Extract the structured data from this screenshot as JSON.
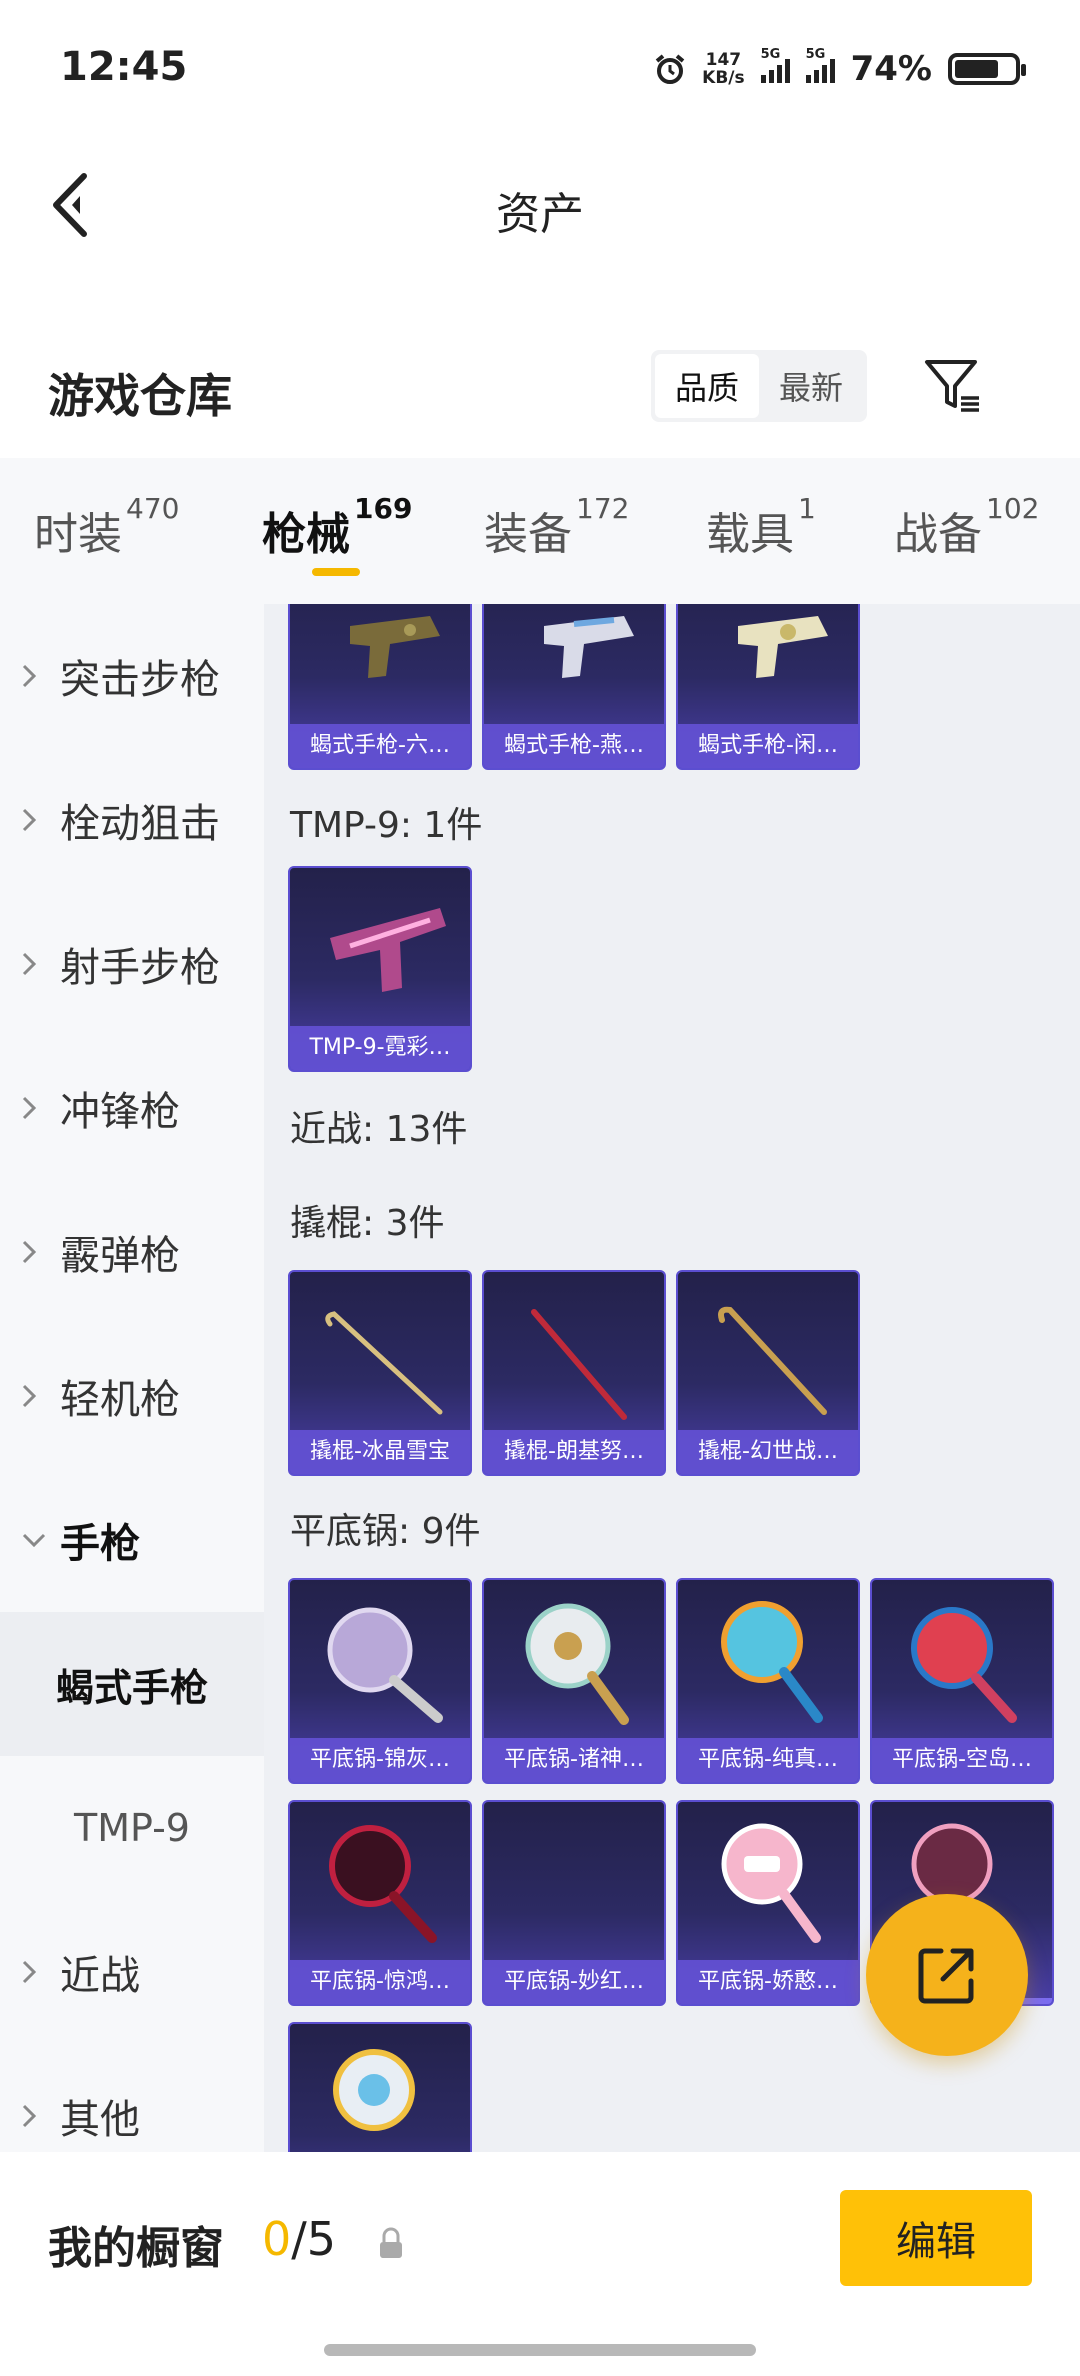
{
  "status_bar": {
    "time": "12:45",
    "net_speed_value": "147",
    "net_speed_unit": "KB/s",
    "signal_1_label": "5G",
    "signal_2_label": "5G",
    "battery_percent": "74%",
    "battery_level": 0.74,
    "icons": [
      "alarm-icon",
      "signal-icon",
      "battery-icon"
    ]
  },
  "header": {
    "title": "资产"
  },
  "warehouse": {
    "title": "游戏仓库",
    "sort_options": [
      "品质",
      "最新"
    ],
    "sort_selected": "品质"
  },
  "tabs": [
    {
      "label": "时装",
      "count": "470"
    },
    {
      "label": "枪械",
      "count": "169",
      "active": true
    },
    {
      "label": "装备",
      "count": "172"
    },
    {
      "label": "载具",
      "count": "1"
    },
    {
      "label": "战备",
      "count": "102"
    }
  ],
  "left_nav": {
    "items": [
      "突击步枪",
      "栓动狙击",
      "射手步枪",
      "冲锋枪",
      "霰弹枪",
      "轻机枪",
      "手枪",
      "近战",
      "其他"
    ],
    "expanded": "手枪",
    "sub_items": [
      "蝎式手枪",
      "TMP-9"
    ],
    "selected_sub": "蝎式手枪"
  },
  "content": {
    "top_cards": [
      "蝎式手枪-六…",
      "蝎式手枪-燕…",
      "蝎式手枪-闲…"
    ],
    "sections": [
      {
        "label": "TMP-9: 1件",
        "cards": [
          "TMP-9-霓彩…"
        ]
      },
      {
        "label": "近战: 13件",
        "cards": []
      },
      {
        "label": "撬棍: 3件",
        "cards": [
          "撬棍-冰晶雪宝",
          "撬棍-朗基努…",
          "撬棍-幻世战…"
        ]
      },
      {
        "label": "平底锅: 9件",
        "cards": [
          "平底锅-锦灰…",
          "平底锅-诸神…",
          "平底锅-纯真…",
          "平底锅-空岛…",
          "平底锅-惊鸿…",
          "平底锅-妙红…",
          "平底锅-娇憨…"
        ]
      }
    ]
  },
  "bottom": {
    "showcase_label": "我的橱窗",
    "showcase_current": "0",
    "showcase_total": "/5",
    "edit_label": "编辑"
  },
  "colors": {
    "accent": "#f5b800",
    "card_bg": "#2c2a63",
    "card_caption": "#6250d2"
  }
}
